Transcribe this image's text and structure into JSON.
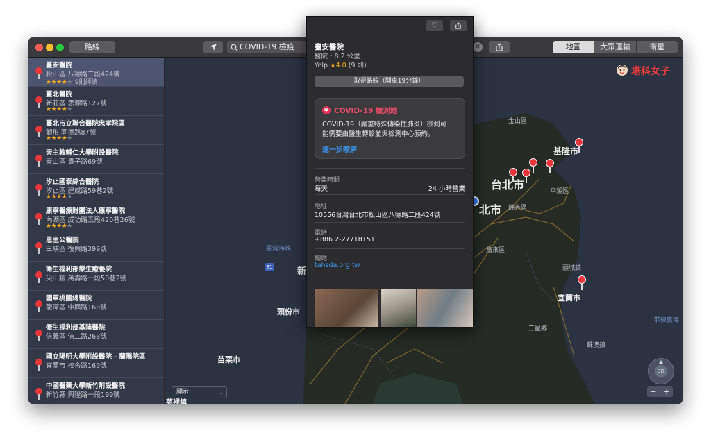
{
  "toolbar": {
    "route_button": "路線",
    "search_value": "COVID-19 檢疫",
    "map_modes": [
      "地圖",
      "大眾運輸",
      "衛星"
    ]
  },
  "sidebar": {
    "items": [
      {
        "name": "臺安醫院",
        "address": "松山區 八德路二段424號",
        "rating": 4,
        "reviews": "9則評論"
      },
      {
        "name": "臺北醫院",
        "address": "新莊區 思源路127號",
        "rating": 4
      },
      {
        "name": "臺北市立聯合醫院忠孝院區",
        "address": "獅形 同德路87號",
        "rating": 4
      },
      {
        "name": "天主教輔仁大學附設醫院",
        "address": "泰山區 貴子路69號"
      },
      {
        "name": "汐止國泰綜合醫院",
        "address": "汐止區 建成路59巷2號",
        "rating": 4
      },
      {
        "name": "康寧醫療財團法人康寧醫院",
        "address": "內湖區 成功路五段420巷26號",
        "rating": 4
      },
      {
        "name": "恩主公醫院",
        "address": "三峽區 復興路399號"
      },
      {
        "name": "衛生福利部樂生療養院",
        "address": "尖山腳 萬壽路一段50巷2號"
      },
      {
        "name": "國軍桃園總醫院",
        "address": "龍潭區 中興路168號"
      },
      {
        "name": "衛生福利部基隆醫院",
        "address": "信義區 信二路268號"
      },
      {
        "name": "國立陽明大學附設醫院 - 蘭陽院區",
        "address": "宜蘭市 校舍路169號"
      },
      {
        "name": "中國醫藥大學新竹附設醫院",
        "address": "新竹縣 興隆路一段199號"
      }
    ]
  },
  "map": {
    "labels": {
      "taipei": "台北市",
      "keelung": "基隆市",
      "yilan": "宜蘭市",
      "toufen": "頭份市",
      "miaoli": "苗栗市",
      "partial_north": "北市",
      "partial_xin": "新",
      "partial_bottom": "苑裡鎮",
      "road": "81",
      "jinshan": "金山區",
      "pingxi": "平溪區",
      "ruifang": "瑞芳區",
      "wulai": "烏來區",
      "sanxing": "三星鄉",
      "suao": "蘇澳鎮",
      "toucheng": "頭城鎮",
      "taiwan_strait": "臺灣海峽",
      "pacific": "菲律賓海"
    },
    "display_select": "顯示",
    "watermark": "塔科女子",
    "zoom_minus": "−",
    "zoom_plus": "+",
    "compass_label": "3D"
  },
  "popup": {
    "title": "臺安醫院",
    "subtitle": "醫院・8.2 公里",
    "yelp_label": "Yelp",
    "yelp_score": "★4.0",
    "yelp_count": "(9 則)",
    "route_button": "取得路線（開車19分鐘）",
    "covid_title": "COVID-19 檢測站",
    "covid_text_line1": "COVID-19（嚴重特殊傳染性肺炎）檢測可",
    "covid_text_line2": "能需要由醫生轉診並與檢測中心預約。",
    "covid_link": "進一步瞭解",
    "hours_label": "營業時間",
    "hours_day": "每天",
    "hours_value": "24 小時營業",
    "address_label": "地址",
    "address_value": "10556台灣台北市松山區八德路二段424號",
    "phone_label": "電話",
    "phone_value": "+886 2-27718151",
    "website_label": "網站",
    "website_value": "tahsda.org.tw"
  }
}
